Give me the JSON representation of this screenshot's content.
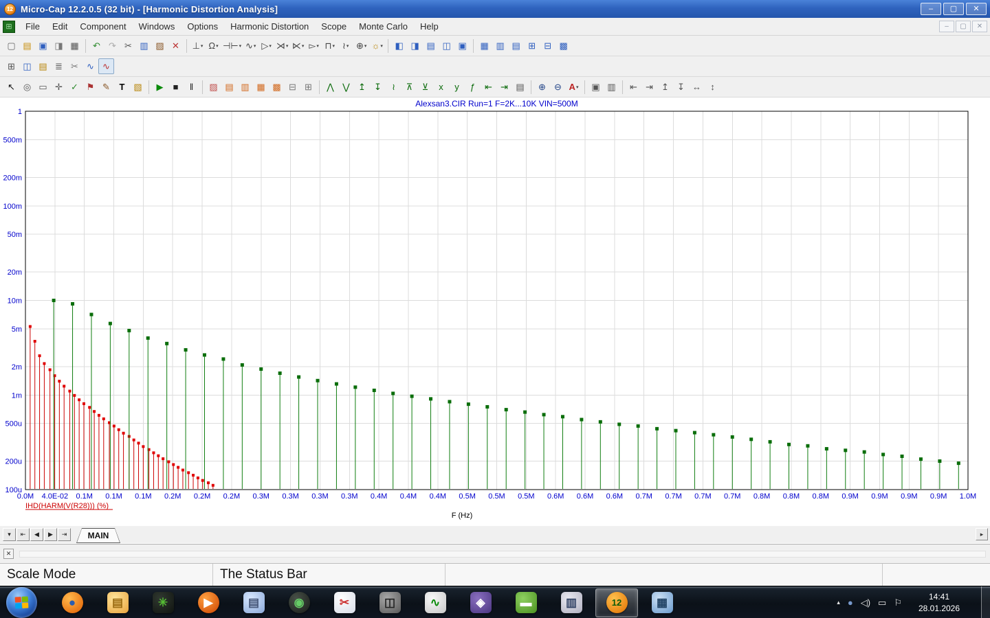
{
  "titlebar": {
    "app_icon_text": "12",
    "title": "Micro-Cap 12.2.0.5 (32 bit) - [Harmonic Distortion Analysis]",
    "minimize": "–",
    "restore": "▢",
    "close": "✕"
  },
  "menu": {
    "child_icon": "⊞",
    "items": [
      "File",
      "Edit",
      "Component",
      "Windows",
      "Options",
      "Harmonic Distortion",
      "Scope",
      "Monte Carlo",
      "Help"
    ],
    "mdi_minimize": "–",
    "mdi_restore": "▢",
    "mdi_close": "✕"
  },
  "toolbars": {
    "row1": [
      {
        "n": "new-circuit-button",
        "g": "▢",
        "c": "#666"
      },
      {
        "n": "open-circuit-button",
        "g": "▤",
        "c": "#c89010"
      },
      {
        "n": "save-button",
        "g": "▣",
        "c": "#2f5fbf"
      },
      {
        "n": "print-preview-button",
        "g": "◨",
        "c": "#777"
      },
      {
        "n": "print-button",
        "g": "▦",
        "c": "#555",
        "s": 1
      },
      {
        "n": "undo-button",
        "g": "↶",
        "c": "#2e8b2e"
      },
      {
        "n": "redo-button",
        "g": "↷",
        "c": "#aaaaaa"
      },
      {
        "n": "cut-button",
        "g": "✂",
        "c": "#555"
      },
      {
        "n": "copy-button",
        "g": "▥",
        "c": "#2f5fbf"
      },
      {
        "n": "paste-button",
        "g": "▨",
        "c": "#8b5a2b"
      },
      {
        "n": "delete-button",
        "g": "✕",
        "c": "#bb3333",
        "s": 1
      },
      {
        "n": "ground-component-button",
        "g": "⊥",
        "c": "#444",
        "d": 1
      },
      {
        "n": "resistor-component-button",
        "g": "Ω",
        "c": "#444",
        "d": 1
      },
      {
        "n": "capacitor-component-button",
        "g": "⊣⊢",
        "c": "#444",
        "d": 1
      },
      {
        "n": "inductor-component-button",
        "g": "∿",
        "c": "#444",
        "d": 1
      },
      {
        "n": "diode-component-button",
        "g": "▷",
        "c": "#444",
        "d": 1
      },
      {
        "n": "npn-transistor-component-button",
        "g": "⋊",
        "c": "#444",
        "d": 1
      },
      {
        "n": "pnp-transistor-component-button",
        "g": "⋉",
        "c": "#444",
        "d": 1
      },
      {
        "n": "opamp-component-button",
        "g": "▻",
        "c": "#444",
        "d": 1
      },
      {
        "n": "pulse-source-component-button",
        "g": "⊓",
        "c": "#444",
        "d": 1
      },
      {
        "n": "sine-source-component-button",
        "g": "≀",
        "c": "#444",
        "d": 1
      },
      {
        "n": "node-component-button",
        "g": "⊕",
        "c": "#444",
        "d": 1
      },
      {
        "n": "animate-component-button",
        "g": "☼",
        "c": "#b8860b",
        "d": 1,
        "s": 1
      },
      {
        "n": "split-text-circuit-button",
        "g": "◧",
        "c": "#2f5fbf"
      },
      {
        "n": "split-vertical-button",
        "g": "◨",
        "c": "#2f5fbf"
      },
      {
        "n": "text-window-button",
        "g": "▤",
        "c": "#2f5fbf"
      },
      {
        "n": "tile-windows-button",
        "g": "◫",
        "c": "#2f5fbf"
      },
      {
        "n": "info-window-button",
        "g": "▣",
        "c": "#2f5fbf",
        "s": 1
      },
      {
        "n": "cascade-windows-button",
        "g": "▦",
        "c": "#2f5fbf"
      },
      {
        "n": "tile-vertical-button",
        "g": "▥",
        "c": "#2f5fbf"
      },
      {
        "n": "tile-horizontal-button",
        "g": "▤",
        "c": "#2f5fbf"
      },
      {
        "n": "overlap-windows-button",
        "g": "⊞",
        "c": "#2f5fbf"
      },
      {
        "n": "maximize-window-button",
        "g": "⊟",
        "c": "#2f5fbf"
      },
      {
        "n": "component-browser-button",
        "g": "▩",
        "c": "#2f5fbf"
      }
    ],
    "row2": [
      {
        "n": "panel-toggle-button",
        "g": "⊞",
        "c": "#555"
      },
      {
        "n": "window-toggle-button",
        "g": "◫",
        "c": "#2f5fbf"
      },
      {
        "n": "annotation-button",
        "g": "▤",
        "c": "#b8860b"
      },
      {
        "n": "watch-list-button",
        "g": "≣",
        "c": "#555"
      },
      {
        "n": "cleanup-button",
        "g": "✂",
        "c": "#777"
      },
      {
        "n": "analysis-limits-button",
        "g": "∿",
        "c": "#2f5fbf"
      },
      {
        "n": "plot-window-button",
        "g": "∿",
        "c": "#bb3333",
        "sel": 1
      }
    ],
    "row3": [
      {
        "n": "select-mode-button",
        "g": "↖",
        "c": "#111"
      },
      {
        "n": "pan-mode-button",
        "g": "◎",
        "c": "#555"
      },
      {
        "n": "graphics-mode-button",
        "g": "▭",
        "c": "#555"
      },
      {
        "n": "zoom-mode-button",
        "g": "✛",
        "c": "#555"
      },
      {
        "n": "point-tag-button",
        "g": "✓",
        "c": "#2e8b2e"
      },
      {
        "n": "flag-mode-button",
        "g": "⚑",
        "c": "#aa3333"
      },
      {
        "n": "pencil-button",
        "g": "✎",
        "c": "#8b5a2b"
      },
      {
        "n": "text-mode-button",
        "g": "T",
        "c": "#000"
      },
      {
        "n": "picture-button",
        "g": "▧",
        "c": "#b8860b",
        "s": 1
      },
      {
        "n": "run-button",
        "g": "▶",
        "c": "#0a8a0a"
      },
      {
        "n": "stop-button",
        "g": "■",
        "c": "#222"
      },
      {
        "n": "pause-button",
        "g": "‖",
        "c": "#222",
        "s": 1
      },
      {
        "n": "slider-button",
        "g": "▨",
        "c": "#c0504d"
      },
      {
        "n": "data-points-button",
        "g": "▤",
        "c": "#d2691e"
      },
      {
        "n": "tokens-button",
        "g": "▥",
        "c": "#d2691e"
      },
      {
        "n": "ruler-button",
        "g": "▦",
        "c": "#d2691e"
      },
      {
        "n": "plus-marks-button",
        "g": "▩",
        "c": "#d2691e"
      },
      {
        "n": "horizontal-axis-grids-button",
        "g": "⊟",
        "c": "#777"
      },
      {
        "n": "vertical-axis-grids-button",
        "g": "⊞",
        "c": "#777",
        "s": 1
      },
      {
        "n": "peak-button",
        "g": "⋀",
        "c": "#0a6a0a"
      },
      {
        "n": "valley-button",
        "g": "⋁",
        "c": "#0a6a0a"
      },
      {
        "n": "high-button",
        "g": "↥",
        "c": "#0a6a0a"
      },
      {
        "n": "low-button",
        "g": "↧",
        "c": "#0a6a0a"
      },
      {
        "n": "inflection-button",
        "g": "≀",
        "c": "#0a6a0a"
      },
      {
        "n": "global-high-button",
        "g": "⊼",
        "c": "#0a6a0a"
      },
      {
        "n": "global-low-button",
        "g": "⊻",
        "c": "#0a6a0a"
      },
      {
        "n": "go-to-x-button",
        "g": "x",
        "c": "#0a6a0a"
      },
      {
        "n": "go-to-y-button",
        "g": "y",
        "c": "#0a6a0a"
      },
      {
        "n": "go-to-performance-button",
        "g": "ƒ",
        "c": "#0a6a0a"
      },
      {
        "n": "tag-left-cursor-button",
        "g": "⇤",
        "c": "#0a6a0a"
      },
      {
        "n": "tag-right-cursor-button",
        "g": "⇥",
        "c": "#0a6a0a"
      },
      {
        "n": "numeric-output-button",
        "g": "▤",
        "c": "#555",
        "s": 1
      },
      {
        "n": "zoom-in-button",
        "g": "⊕",
        "c": "#224488"
      },
      {
        "n": "zoom-out-button",
        "g": "⊖",
        "c": "#224488"
      },
      {
        "n": "autoscale-button",
        "g": "A",
        "c": "#bb2222",
        "d": 1,
        "s": 1
      },
      {
        "n": "copy-graph-button",
        "g": "▣",
        "c": "#555"
      },
      {
        "n": "copy-cursor-values-button",
        "g": "▥",
        "c": "#555",
        "s": 1
      },
      {
        "n": "align-left-button",
        "g": "⇤",
        "c": "#555"
      },
      {
        "n": "align-right-button",
        "g": "⇥",
        "c": "#555"
      },
      {
        "n": "align-top-button",
        "g": "↥",
        "c": "#555"
      },
      {
        "n": "align-bottom-button",
        "g": "↧",
        "c": "#555"
      },
      {
        "n": "distribute-horizontal-button",
        "g": "↔",
        "c": "#555"
      },
      {
        "n": "distribute-vertical-button",
        "g": "↕",
        "c": "#555"
      }
    ]
  },
  "chart_data": {
    "type": "stem",
    "title": "Alexsan3.CIR Run=1 F=2K...10K VIN=500M",
    "xlabel": "F (Hz)",
    "legend": "IHD(HARM(V(R28))) (%)",
    "x_unit": "MHz",
    "xlim": [
      0,
      1.0
    ],
    "ylim": [
      0.0001,
      1
    ],
    "ylog": true,
    "grid": true,
    "title_color": "#0000cc",
    "axis_color": "#0000cc",
    "xlabel_color": "#000000",
    "legend_color": "#cc0000",
    "grid_color": "#dcdcdc",
    "border_color": "#000000",
    "x_ticks": [
      "0.0M",
      "4.0E-02",
      "0.1M",
      "0.1M",
      "0.1M",
      "0.2M",
      "0.2M",
      "0.2M",
      "0.3M",
      "0.3M",
      "0.3M",
      "0.3M",
      "0.4M",
      "0.4M",
      "0.4M",
      "0.5M",
      "0.5M",
      "0.5M",
      "0.6M",
      "0.6M",
      "0.6M",
      "0.7M",
      "0.7M",
      "0.7M",
      "0.7M",
      "0.8M",
      "0.8M",
      "0.8M",
      "0.9M",
      "0.9M",
      "0.9M",
      "0.9M",
      "1.0M"
    ],
    "y_ticks": [
      {
        "label": "1",
        "value": 1
      },
      {
        "label": "500m",
        "value": 0.5
      },
      {
        "label": "200m",
        "value": 0.2
      },
      {
        "label": "100m",
        "value": 0.1
      },
      {
        "label": "50m",
        "value": 0.05
      },
      {
        "label": "20m",
        "value": 0.02
      },
      {
        "label": "10m",
        "value": 0.01
      },
      {
        "label": "5m",
        "value": 0.005
      },
      {
        "label": "2m",
        "value": 0.002
      },
      {
        "label": "1m",
        "value": 0.001
      },
      {
        "label": "500u",
        "value": 0.0005
      },
      {
        "label": "200u",
        "value": 0.0002
      },
      {
        "label": "100u",
        "value": 0.0001
      }
    ],
    "series": [
      {
        "name": "red-harmonics",
        "color": "#cc0000",
        "marker_color": "#e00000",
        "marker_size": 4,
        "points": [
          [
            0.005,
            0.0053
          ],
          [
            0.01,
            0.0037
          ],
          [
            0.015,
            0.0026
          ],
          [
            0.02,
            0.00215
          ],
          [
            0.026,
            0.00185
          ],
          [
            0.031,
            0.0016
          ],
          [
            0.036,
            0.0014
          ],
          [
            0.041,
            0.00124
          ],
          [
            0.047,
            0.0011
          ],
          [
            0.052,
            0.00099
          ],
          [
            0.057,
            0.00089
          ],
          [
            0.062,
            0.00081
          ],
          [
            0.068,
            0.00074
          ],
          [
            0.073,
            0.00067
          ],
          [
            0.078,
            0.00061
          ],
          [
            0.083,
            0.00056
          ],
          [
            0.089,
            0.00051
          ],
          [
            0.094,
            0.00047
          ],
          [
            0.099,
            0.00043
          ],
          [
            0.104,
            0.000395
          ],
          [
            0.11,
            0.000365
          ],
          [
            0.115,
            0.000335
          ],
          [
            0.12,
            0.00031
          ],
          [
            0.125,
            0.000285
          ],
          [
            0.131,
            0.000265
          ],
          [
            0.136,
            0.000245
          ],
          [
            0.141,
            0.000228
          ],
          [
            0.146,
            0.000212
          ],
          [
            0.152,
            0.000197
          ],
          [
            0.157,
            0.000184
          ],
          [
            0.162,
            0.000172
          ],
          [
            0.167,
            0.000161
          ],
          [
            0.173,
            0.000151
          ],
          [
            0.178,
            0.000142
          ],
          [
            0.183,
            0.000133
          ],
          [
            0.188,
            0.000125
          ],
          [
            0.194,
            0.000118
          ],
          [
            0.199,
            0.000111
          ]
        ]
      },
      {
        "name": "green-harmonics",
        "color": "#0f7d0f",
        "marker_color": "#0b6e0b",
        "marker_size": 5,
        "points": [
          [
            0.03,
            0.01
          ],
          [
            0.05,
            0.0092
          ],
          [
            0.07,
            0.0071
          ],
          [
            0.09,
            0.0057
          ],
          [
            0.11,
            0.0048
          ],
          [
            0.13,
            0.004
          ],
          [
            0.15,
            0.0035
          ],
          [
            0.17,
            0.003
          ],
          [
            0.19,
            0.00265
          ],
          [
            0.21,
            0.0024
          ],
          [
            0.23,
            0.00208
          ],
          [
            0.25,
            0.00188
          ],
          [
            0.27,
            0.0017
          ],
          [
            0.29,
            0.00155
          ],
          [
            0.31,
            0.00142
          ],
          [
            0.33,
            0.00131
          ],
          [
            0.35,
            0.00121
          ],
          [
            0.37,
            0.00112
          ],
          [
            0.39,
            0.00104
          ],
          [
            0.41,
            0.00097
          ],
          [
            0.43,
            0.00091
          ],
          [
            0.45,
            0.00085
          ],
          [
            0.47,
            0.0008
          ],
          [
            0.49,
            0.00075
          ],
          [
            0.51,
            0.0007
          ],
          [
            0.53,
            0.00066
          ],
          [
            0.55,
            0.00062
          ],
          [
            0.57,
            0.00059
          ],
          [
            0.59,
            0.00055
          ],
          [
            0.61,
            0.00052
          ],
          [
            0.63,
            0.00049
          ],
          [
            0.65,
            0.00047
          ],
          [
            0.67,
            0.00044
          ],
          [
            0.69,
            0.00042
          ],
          [
            0.71,
            0.0004
          ],
          [
            0.73,
            0.00038
          ],
          [
            0.75,
            0.00036
          ],
          [
            0.77,
            0.00034
          ],
          [
            0.79,
            0.00032
          ],
          [
            0.81,
            0.0003
          ],
          [
            0.83,
            0.00029
          ],
          [
            0.85,
            0.00027
          ],
          [
            0.87,
            0.00026
          ],
          [
            0.89,
            0.00025
          ],
          [
            0.91,
            0.000235
          ],
          [
            0.93,
            0.000225
          ],
          [
            0.95,
            0.00021
          ],
          [
            0.97,
            0.0002
          ],
          [
            0.99,
            0.00019
          ]
        ]
      }
    ]
  },
  "tabbar": {
    "nav": [
      {
        "n": "page-list-button",
        "g": "▾"
      },
      {
        "n": "first-page-button",
        "g": "⇤"
      },
      {
        "n": "prev-page-button",
        "g": "◀"
      },
      {
        "n": "next-page-button",
        "g": "▶"
      },
      {
        "n": "last-page-button",
        "g": "⇥"
      }
    ],
    "tab_label": "MAIN",
    "scroll_right": "▸"
  },
  "panel": {
    "close": "✕"
  },
  "statusbar": {
    "sections": [
      "Scale Mode",
      "The Status Bar",
      "",
      ""
    ]
  },
  "taskbar": {
    "start_colors": [
      "#f25022",
      "#7fba00",
      "#00a4ef",
      "#ffb900"
    ],
    "apps": [
      {
        "n": "firefox-icon",
        "c1": "#ffb84d",
        "c2": "#e05e00",
        "g": "●",
        "gc": "#2a5db0",
        "shape": "circle"
      },
      {
        "n": "windows-explorer-icon",
        "c1": "#ffe49a",
        "c2": "#e8a33d",
        "g": "▤",
        "gc": "#9a6a10"
      },
      {
        "n": "spider-player-icon",
        "c1": "#303830",
        "c2": "#101410",
        "g": "✳",
        "gc": "#55bb33"
      },
      {
        "n": "media-player-icon",
        "c1": "#ffa040",
        "c2": "#cc4400",
        "g": "▶",
        "gc": "#ffffff",
        "shape": "circle"
      },
      {
        "n": "sticky-notes-icon",
        "c1": "#d8e8ff",
        "c2": "#8aa8d8",
        "g": "▤",
        "gc": "#445577"
      },
      {
        "n": "kmplayer-icon",
        "c1": "#485048",
        "c2": "#181c18",
        "g": "◉",
        "gc": "#66cc66",
        "shape": "circle"
      },
      {
        "n": "snipping-tool-icon",
        "c1": "#ffffff",
        "c2": "#d8dde8",
        "g": "✂",
        "gc": "#cc3333"
      },
      {
        "n": "multimeter-icon",
        "c1": "#a8a8a8",
        "c2": "#585858",
        "g": "◫",
        "gc": "#222222"
      },
      {
        "n": "oscilloscope-icon",
        "c1": "#f8f8f8",
        "c2": "#c8c8c8",
        "g": "∿",
        "gc": "#0a8a0a"
      },
      {
        "n": "djview-icon",
        "c1": "#8a6fc0",
        "c2": "#4a3580",
        "g": "◈",
        "gc": "#ffffff"
      },
      {
        "n": "movie-maker-icon",
        "c1": "#8ed060",
        "c2": "#4a9020",
        "g": "▬",
        "gc": "#ffffff"
      },
      {
        "n": "winrar-icon",
        "c1": "#e8e8f0",
        "c2": "#b0b0c0",
        "g": "▥",
        "gc": "#334466"
      },
      {
        "n": "microcap-icon",
        "c1": "#ffc04d",
        "c2": "#e07000",
        "g": "12",
        "gc": "#0a5a0a",
        "shape": "circle",
        "active": 1
      },
      {
        "n": "photo-viewer-icon",
        "c1": "#cce0f4",
        "c2": "#6899cc",
        "g": "▦",
        "gc": "#224466"
      }
    ],
    "tray": [
      {
        "n": "show-hidden-icons-button",
        "g": "▴",
        "gc": "#e8e8e8",
        "small": 1
      },
      {
        "n": "tray-app-icon",
        "g": "●",
        "gc": "#7799cc"
      },
      {
        "n": "volume-icon",
        "g": "◁)",
        "gc": "#e8e8e8"
      },
      {
        "n": "display-icon",
        "g": "▭",
        "gc": "#e8e8e8"
      },
      {
        "n": "action-center-icon",
        "g": "⚐",
        "gc": "#e8e8e8"
      }
    ],
    "clock": {
      "time": "14:41",
      "date": "28.01.2026"
    }
  }
}
